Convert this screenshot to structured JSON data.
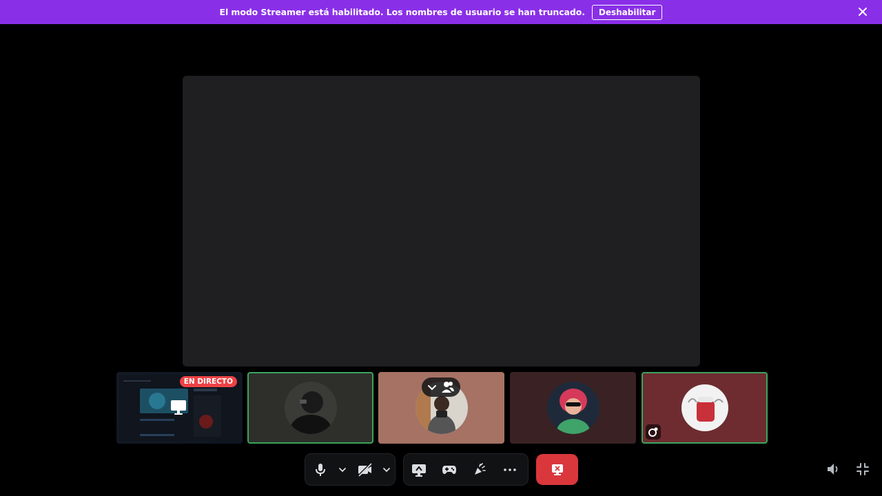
{
  "banner": {
    "message": "El modo Streamer está habilitado. Los nombres de usuario se han truncado.",
    "disable_label": "Deshabilitar",
    "close_icon": "close-icon"
  },
  "tiles": {
    "screen_share": {
      "live_badge": "EN DIRECTO",
      "icon": "monitor-icon"
    },
    "participants": [
      {
        "speaking": true,
        "icon": "avatar"
      },
      {
        "speaking": false,
        "icon": "avatar",
        "overlay_icons": [
          "chevron-down-icon",
          "people-icon"
        ]
      },
      {
        "speaking": false,
        "icon": "avatar"
      },
      {
        "speaking": true,
        "icon": "avatar",
        "activity_icon": "activity-icon"
      }
    ]
  },
  "controls": {
    "left": [
      "microphone-icon",
      "chevron-down-icon",
      "camera-off-icon",
      "chevron-down-icon"
    ],
    "middle": [
      "screen-share-icon",
      "gamepad-icon",
      "soundboard-icon",
      "more-icon"
    ],
    "hangup": "leave-call-icon",
    "right": [
      "volume-icon",
      "shrink-icon"
    ]
  },
  "colors": {
    "banner": "#8a2fe8",
    "speaking": "#3ba55d",
    "hangup": "#da373c",
    "live": "#ed4245"
  }
}
